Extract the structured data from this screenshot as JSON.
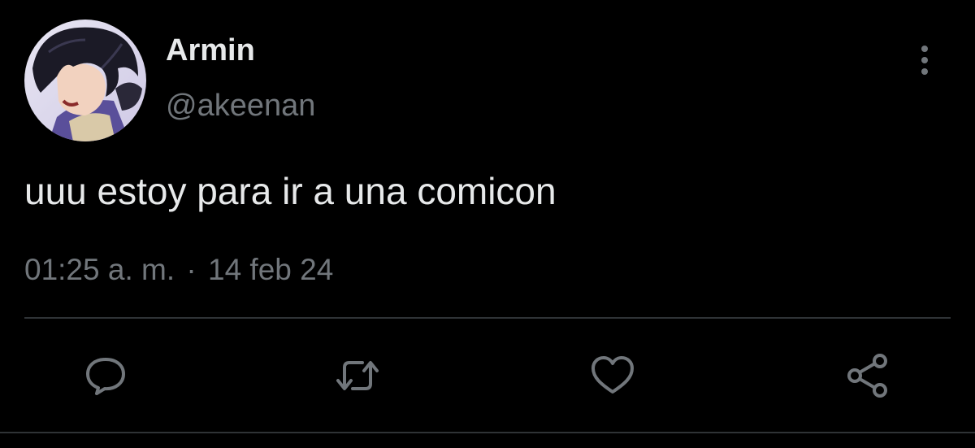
{
  "author": {
    "display_name": "Armin",
    "handle": "@akeenan",
    "avatar_icon": "anime-character-avatar"
  },
  "tweet": {
    "text": "uuu estoy para ir a una comicon",
    "time": "01:25 a. m.",
    "separator": "·",
    "date": "14 feb 24"
  },
  "actions": {
    "reply_icon": "speech-bubble-icon",
    "retweet_icon": "retweet-arrows-icon",
    "like_icon": "heart-icon",
    "share_icon": "share-icon"
  },
  "colors": {
    "background": "#000000",
    "primary_text": "#e7e9ea",
    "secondary_text": "#71767b",
    "divider": "#2f3336"
  }
}
